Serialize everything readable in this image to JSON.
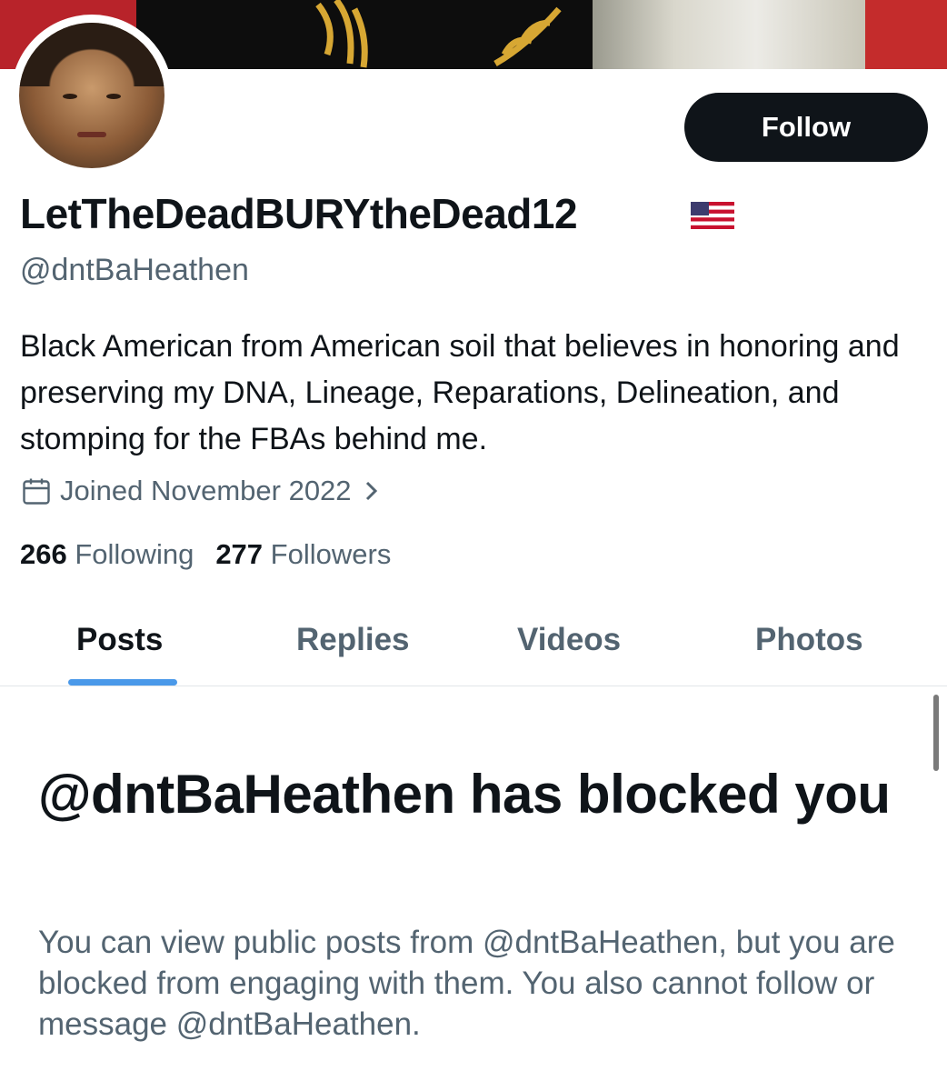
{
  "profile": {
    "display_name": "LetTheDeadBURYtheDead12",
    "handle": "@dntBaHeathen",
    "bio": "Black American from American soil that believes in honoring and preserving my DNA, Lineage, Reparations, Delineation, and stomping for the FBAs behind me.",
    "joined": "Joined November 2022",
    "following_count": "266",
    "following_label": "Following",
    "followers_count": "277",
    "followers_label": "Followers"
  },
  "actions": {
    "follow_label": "Follow"
  },
  "tabs": [
    {
      "label": "Posts",
      "active": true
    },
    {
      "label": "Replies",
      "active": false
    },
    {
      "label": "Videos",
      "active": false
    },
    {
      "label": "Photos",
      "active": false
    }
  ],
  "blocked": {
    "title": "@dntBaHeathen has blocked you",
    "description": "You can view public posts from @dntBaHeathen, but you are blocked from engaging with them. You also cannot follow or message @dntBaHeathen."
  },
  "icons": {
    "calendar": "calendar-icon",
    "chevron": "chevron-right-icon",
    "flag": "us-flag-emoji"
  },
  "colors": {
    "text_primary": "#0f1419",
    "text_secondary": "#536471",
    "tab_indicator": "#4a99e9",
    "follow_button": "#0f1419"
  }
}
